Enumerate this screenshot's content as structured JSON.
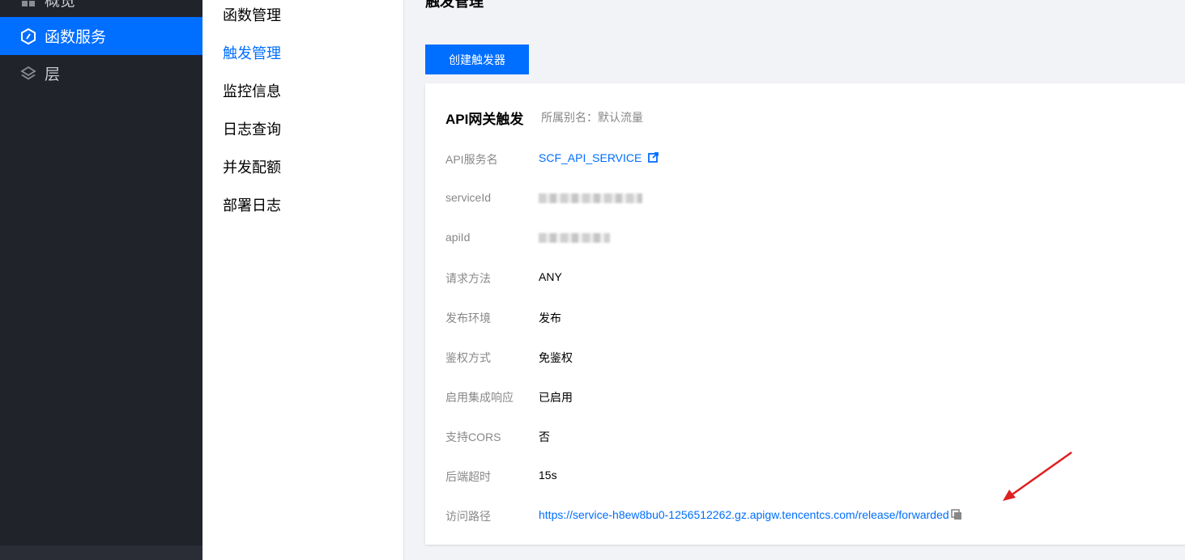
{
  "sidebar": {
    "items": [
      {
        "label": "概览",
        "icon": "overview-icon"
      },
      {
        "label": "函数服务",
        "icon": "function-icon"
      },
      {
        "label": "层",
        "icon": "layers-icon"
      }
    ]
  },
  "submenu": {
    "items": [
      "函数管理",
      "触发管理",
      "监控信息",
      "日志查询",
      "并发配额",
      "部署日志"
    ]
  },
  "main": {
    "title": "触发管理",
    "create_button": "创建触发器",
    "card": {
      "title": "API网关触发",
      "alias": "所属别名：默认流量",
      "rows": {
        "api_service": {
          "label": "API服务名",
          "value": "SCF_API_SERVICE"
        },
        "service_id": {
          "label": "serviceId"
        },
        "api_id": {
          "label": "apiId"
        },
        "method": {
          "label": "请求方法",
          "value": "ANY"
        },
        "env": {
          "label": "发布环境",
          "value": "发布"
        },
        "auth": {
          "label": "鉴权方式",
          "value": "免鉴权"
        },
        "integration": {
          "label": "启用集成响应",
          "value": "已启用"
        },
        "cors": {
          "label": "支持CORS",
          "value": "否"
        },
        "timeout": {
          "label": "后端超时",
          "value": "15s"
        },
        "path": {
          "label": "访问路径",
          "value": "https://service-h8ew8bu0-1256512262.gz.apigw.tencentcs.com/release/forwarded"
        }
      }
    }
  },
  "colors": {
    "accent": "#006eff",
    "sidebar_bg": "#21232b",
    "annotation_arrow": "#e02020"
  }
}
